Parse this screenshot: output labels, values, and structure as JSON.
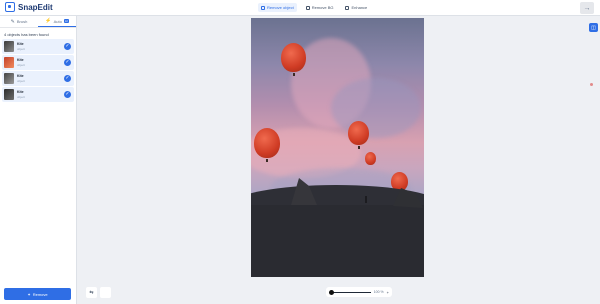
{
  "app": {
    "name": "SnapEdit"
  },
  "top_tabs": [
    {
      "label": "Remove object",
      "active": true
    },
    {
      "label": "Remove BG",
      "active": false
    },
    {
      "label": "Enhance",
      "active": false
    }
  ],
  "panel_tabs": [
    {
      "label": "Brush",
      "active": false
    },
    {
      "label": "Auto",
      "badge": "AI",
      "active": true
    }
  ],
  "detected_text": "4 objects has been found",
  "objects": [
    {
      "name": "Kite",
      "sub": "object",
      "checked": true
    },
    {
      "name": "Kite",
      "sub": "object",
      "checked": true
    },
    {
      "name": "Kite",
      "sub": "object",
      "checked": true
    },
    {
      "name": "Kite",
      "sub": "object",
      "checked": true
    }
  ],
  "remove_button": "Remove",
  "zoom": {
    "value": "100 %"
  },
  "colors": {
    "accent": "#2f6ee5",
    "balloon": "#d8452c"
  }
}
